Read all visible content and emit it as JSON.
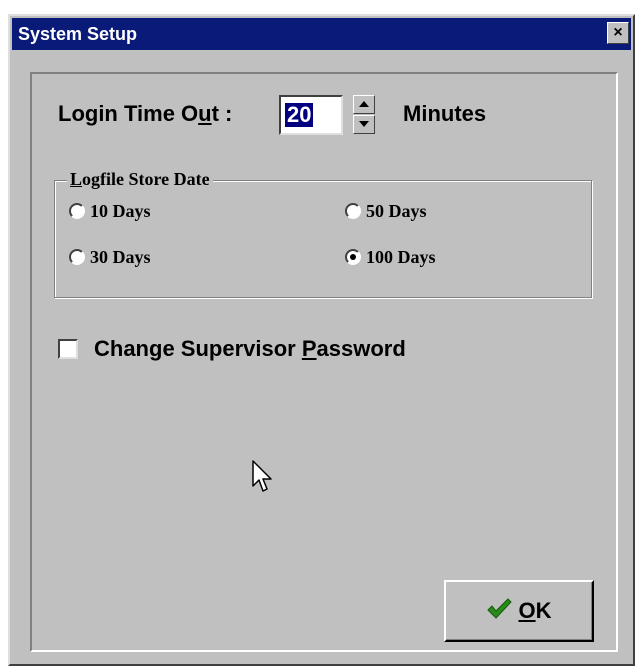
{
  "window": {
    "title": "System Setup",
    "close_glyph": "×",
    "title_color": "#0a1a78"
  },
  "login_timeout": {
    "label_before": "Login Time O",
    "label_ul": "u",
    "label_after": "t :",
    "value": "20",
    "units": "Minutes"
  },
  "logfile": {
    "legend_ul": "L",
    "legend_rest": "ogfile Store Date",
    "options": [
      {
        "label": "10 Days",
        "selected": false
      },
      {
        "label": "50 Days",
        "selected": false
      },
      {
        "label": "30 Days",
        "selected": false
      },
      {
        "label": "100 Days",
        "selected": true
      }
    ]
  },
  "supervisor": {
    "label_before": "Change Supervisor ",
    "label_ul": "P",
    "label_after": "assword",
    "checked": false
  },
  "ok_button": {
    "label_ul": "O",
    "label_rest": "K",
    "icon": "checkmark-icon",
    "icon_color": "#2a8a1a"
  },
  "cursor": {
    "icon": "mouse-pointer-icon"
  }
}
